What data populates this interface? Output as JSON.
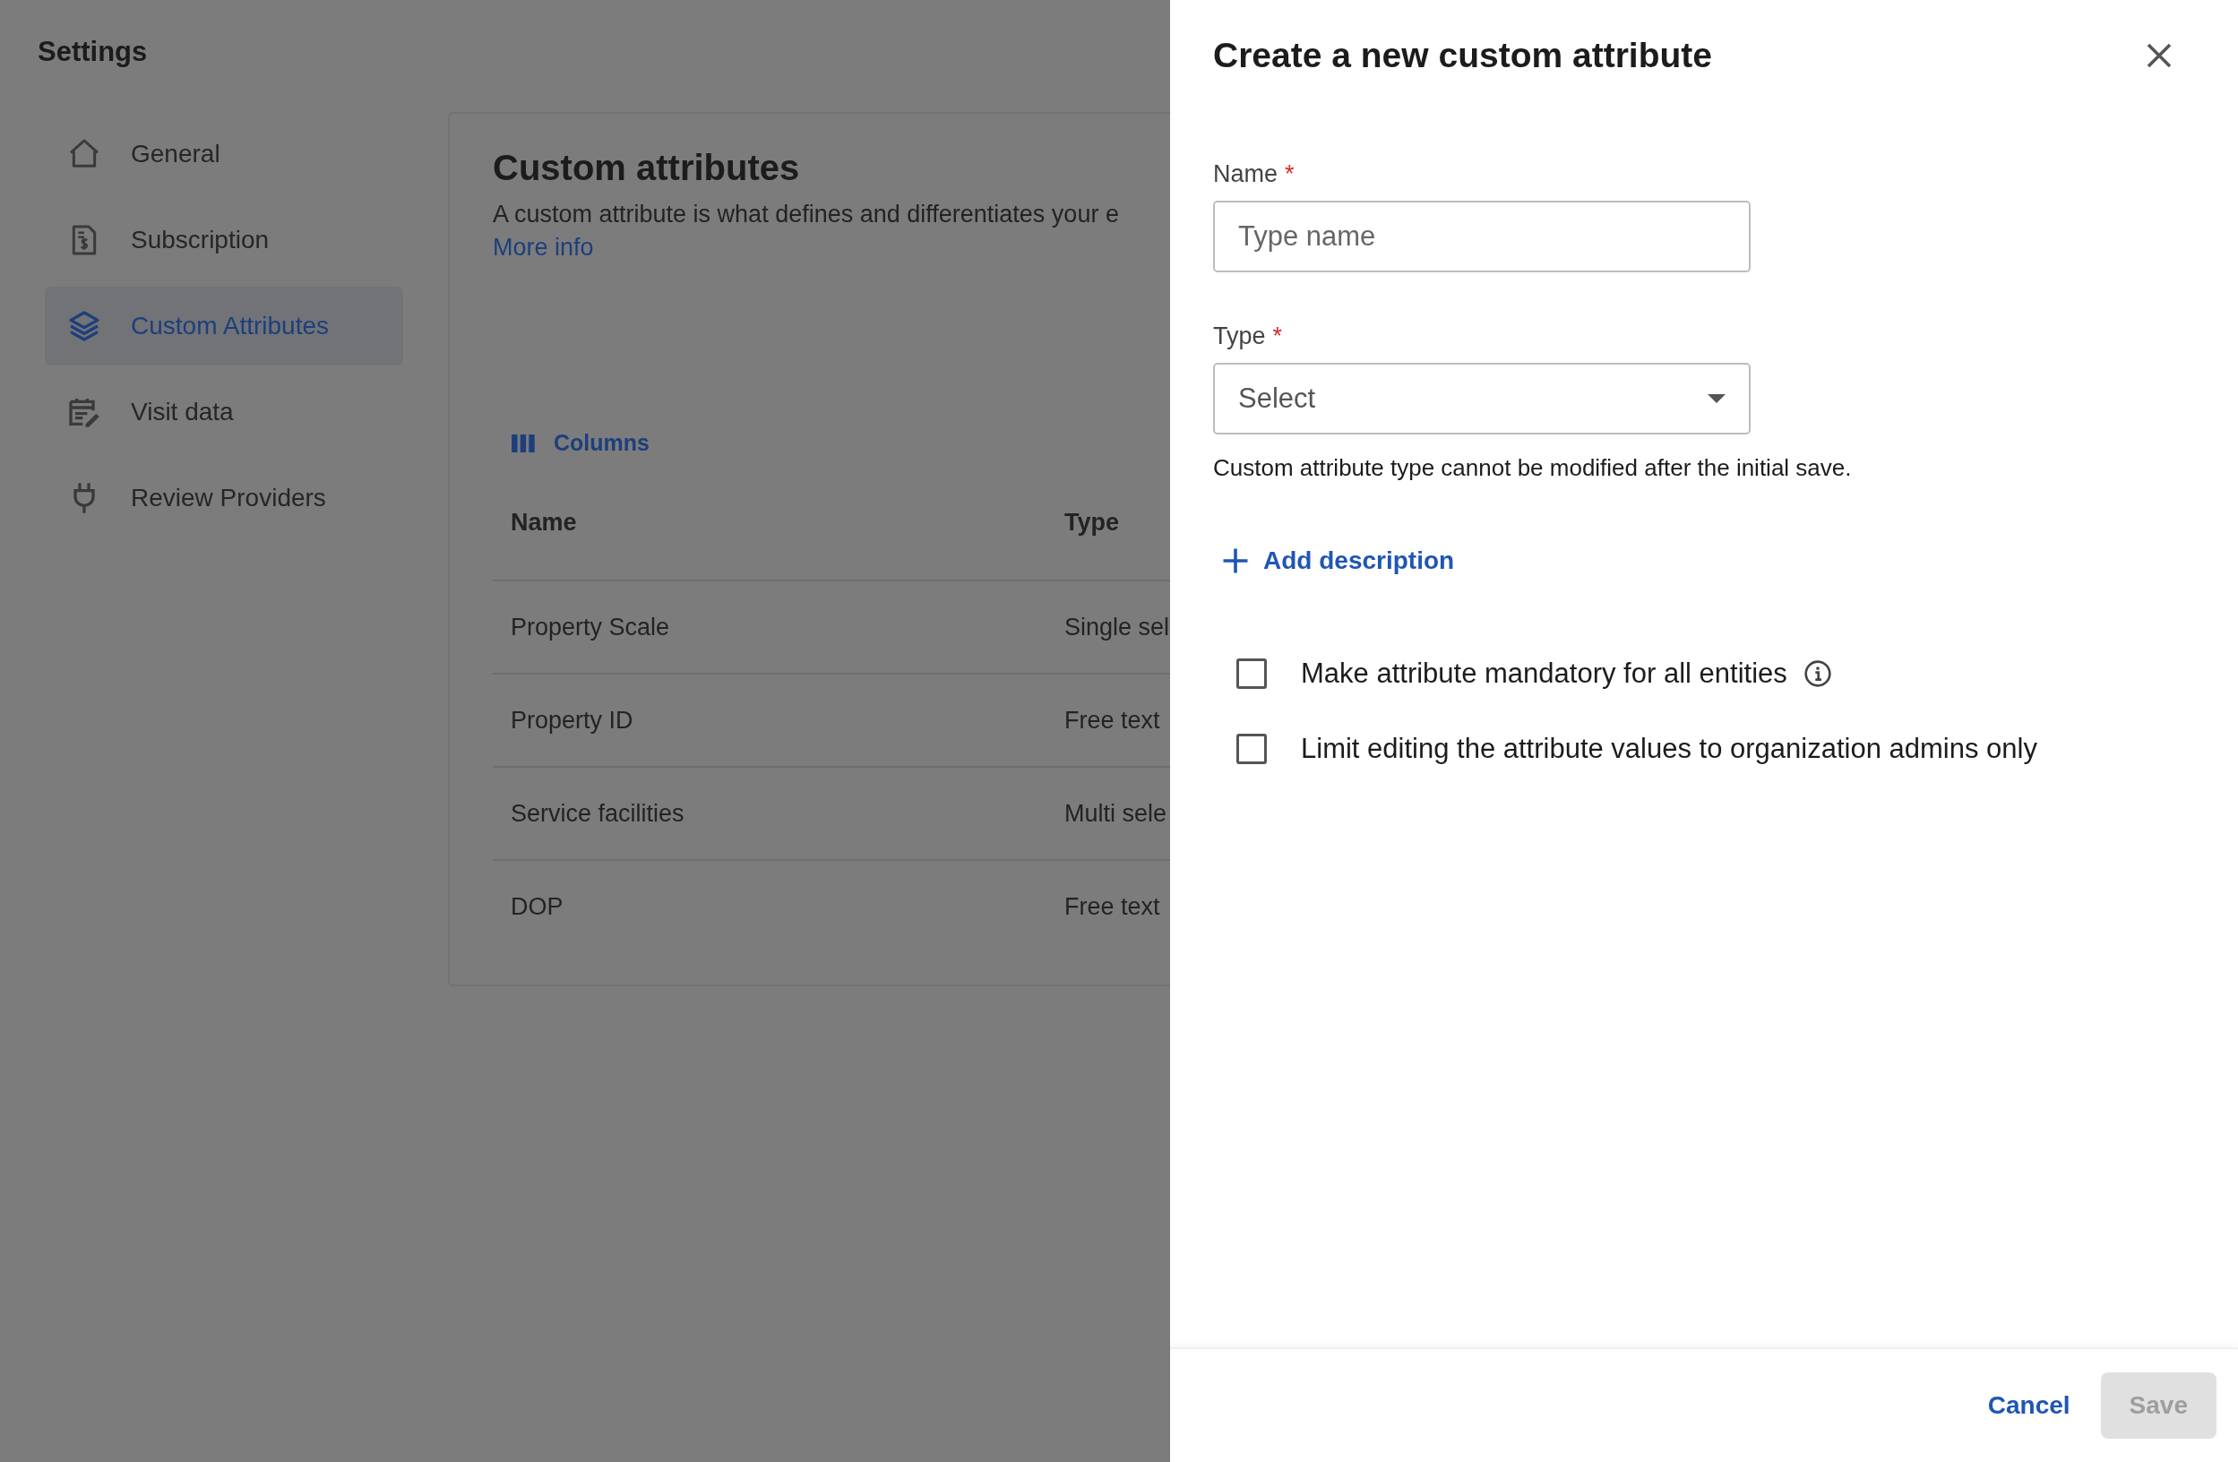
{
  "sidebar": {
    "title": "Settings",
    "items": [
      {
        "label": "General",
        "kind": "home",
        "selected": false
      },
      {
        "label": "Subscription",
        "kind": "invoice",
        "selected": false
      },
      {
        "label": "Custom Attributes",
        "kind": "layers",
        "selected": true
      },
      {
        "label": "Visit data",
        "kind": "calendar-edit",
        "selected": false
      },
      {
        "label": "Review Providers",
        "kind": "plug",
        "selected": false
      }
    ]
  },
  "page": {
    "title": "Custom attributes",
    "description": "A custom attribute is what defines and differentiates your e",
    "link": "More info",
    "columns_button": "Columns",
    "table": {
      "columns": [
        "Name",
        "Type"
      ],
      "rows": [
        [
          "Property Scale",
          "Single sel"
        ],
        [
          "Property ID",
          "Free text"
        ],
        [
          "Service facilities",
          "Multi sele"
        ],
        [
          "DOP",
          "Free text"
        ]
      ]
    }
  },
  "panel": {
    "title": "Create a new custom attribute",
    "fields": [
      {
        "label": "Name",
        "required_mark": "*",
        "kind": "text",
        "placeholder": "Type name"
      },
      {
        "label": "Type",
        "required_mark": "*",
        "kind": "select",
        "placeholder": "Select"
      }
    ],
    "helper": "Custom attribute type cannot be modified after the initial save.",
    "add_link": "Add description",
    "options": [
      {
        "label": "Make attribute mandatory for all entities",
        "checked": false,
        "info": true
      },
      {
        "label": "Limit editing the attribute values to organization admins only",
        "checked": false,
        "info": false
      }
    ],
    "buttons": [
      {
        "label": "Cancel",
        "kind": "text",
        "disabled": false
      },
      {
        "label": "Save",
        "kind": "filled",
        "disabled": true
      }
    ]
  }
}
